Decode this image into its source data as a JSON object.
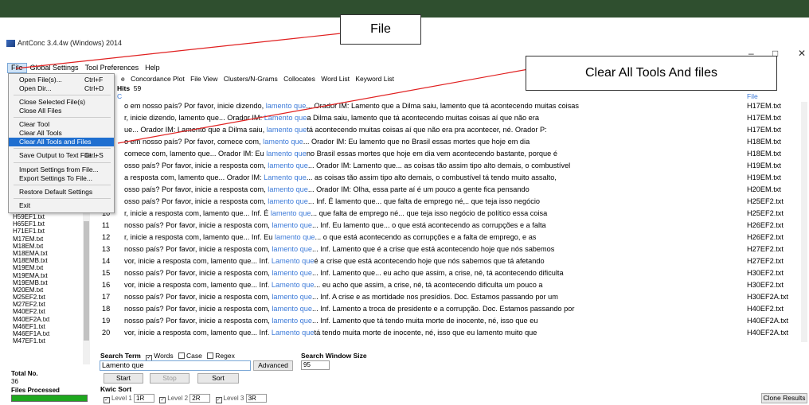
{
  "window": {
    "title": "AntConc 3.4.4w (Windows) 2014",
    "minimize": "–",
    "maximize": "□",
    "close": "✕"
  },
  "menubar": [
    "File",
    "Global Settings",
    "Tool Preferences",
    "Help"
  ],
  "file_menu": [
    {
      "label": "Open File(s)...",
      "shortcut": "Ctrl+F"
    },
    {
      "label": "Open Dir...",
      "shortcut": "Ctrl+D"
    },
    {
      "label": "Close Selected File(s)",
      "shortcut": ""
    },
    {
      "label": "Close All Files",
      "shortcut": ""
    },
    {
      "label": "Clear Tool",
      "shortcut": ""
    },
    {
      "label": "Clear All Tools",
      "shortcut": ""
    },
    {
      "label": "Clear All Tools and Files",
      "shortcut": ""
    },
    {
      "label": "Save Output to Text File...",
      "shortcut": "Ctrl+S"
    },
    {
      "label": "Import Settings from File...",
      "shortcut": ""
    },
    {
      "label": "Export Settings To File...",
      "shortcut": ""
    },
    {
      "label": "Restore Default Settings",
      "shortcut": ""
    },
    {
      "label": "Exit",
      "shortcut": ""
    }
  ],
  "tabs": [
    "e",
    "Concordance Plot",
    "File View",
    "Clusters/N-Grams",
    "Collocates",
    "Word List",
    "Keyword List"
  ],
  "hits_label": "Hits",
  "hits_value": "59",
  "kwic_label": "C",
  "file_label": "File",
  "file_list": [
    "H59EF1.txt",
    "H65EF1.txt",
    "H71EF1.txt",
    "M17EM.txt",
    "M18EM.txt",
    "M18EMA.txt",
    "M18EMB.txt",
    "M19EM.txt",
    "M19EMA.txt",
    "M19EMB.txt",
    "M20EM.txt",
    "M25EF2.txt",
    "M27EF2.txt",
    "M40EF2.txt",
    "M40EF2A.txt",
    "M46EF1.txt",
    "M46EF1A.txt",
    "M47EF1.txt"
  ],
  "total_no_label": "Total No.",
  "total_no_value": "36",
  "files_processed_label": "Files Processed",
  "files_processed_fraction": 1.0,
  "hits": [
    {
      "num": "",
      "left": "o em nosso país? Por favor, inicie dizendo,",
      "kw": "lamento que",
      "right": "... Orador IM: Lamento que a Dilma saiu, lamento que tá acontecendo muitas coisas",
      "file": "H17EM.txt"
    },
    {
      "num": "",
      "left": "r, inicie dizendo, lamento que... Orador IM:",
      "kw": "Lamento que",
      "right": "a Dilma saiu, lamento que tá acontecendo muitas coisas aí que não era",
      "file": "H17EM.txt"
    },
    {
      "num": "",
      "left": "ue... Orador IM: Lamento que a Dilma saiu,",
      "kw": "lamento que",
      "right": "tá acontecendo muitas coisas aí que não era pra acontecer, né. Orador P:",
      "file": "H17EM.txt"
    },
    {
      "num": "",
      "left": "o em nosso país? Por favor, comece com,",
      "kw": "lamento que",
      "right": "... Orador IM: Eu lamento que no Brasil essas mortes que hoje em dia",
      "file": "H18EM.txt"
    },
    {
      "num": "",
      "left": "comece com, lamento que... Orador IM: Eu",
      "kw": "lamento que",
      "right": "no Brasil essas mortes que hoje em dia vem acontecendo bastante, porque é",
      "file": "H18EM.txt"
    },
    {
      "num": "",
      "left": "osso país? Por favor, inicie a resposta com,",
      "kw": "lamento que",
      "right": "... Orador IM: Lamento que... as coisas tão assim tipo alto demais, o combustível",
      "file": "H19EM.txt"
    },
    {
      "num": "",
      "left": "a resposta com, lamento que... Orador IM:",
      "kw": "Lamento que",
      "right": "... as coisas tão assim tipo alto demais, o combustível tá tendo muito assalto,",
      "file": "H19EM.txt"
    },
    {
      "num": "",
      "left": "osso país? Por favor, inicie a resposta com,",
      "kw": "lamento que",
      "right": "... Orador IM: Olha, essa parte aí é um pouco a gente fica pensando",
      "file": "H20EM.txt"
    },
    {
      "num": "",
      "left": "osso país? Por favor, inicie a resposta com,",
      "kw": "lamento que",
      "right": "... Inf. É lamento que... que falta de emprego né,.. que teja isso negócio",
      "file": "H25EF2.txt"
    },
    {
      "num": "10",
      "left": "r, inicie a resposta com, lamento que... Inf. É",
      "kw": "lamento que",
      "right": "... que falta de emprego né... que teja isso negócio de político essa coisa",
      "file": "H25EF2.txt"
    },
    {
      "num": "11",
      "left": "nosso país? Por favor, inicie a resposta com,",
      "kw": "lamento que",
      "right": "... Inf. Eu lamento que... o que está acontecendo as corrupções e a falta",
      "file": "H26EF2.txt"
    },
    {
      "num": "12",
      "left": "r, inicie a resposta com, lamento que... Inf. Eu",
      "kw": "lamento que",
      "right": "... o que está acontecendo as corrupções e a falta de emprego, e as",
      "file": "H26EF2.txt"
    },
    {
      "num": "13",
      "left": "nosso país? Por favor, inicie a resposta com,",
      "kw": "lamento que",
      "right": "... Inf. Lamento que é a crise que está acontecendo hoje que nós sabemos",
      "file": "H27EF2.txt"
    },
    {
      "num": "14",
      "left": "vor, inicie a resposta com, lamento que... Inf.",
      "kw": "Lamento que",
      "right": "é a crise que está acontecendo hoje que nós sabemos que tá afetando",
      "file": "H27EF2.txt"
    },
    {
      "num": "15",
      "left": "nosso país? Por favor, inicie a resposta com,",
      "kw": "lamento que",
      "right": "... Inf. Lamento que... eu acho que assim, a crise, né, tá acontecendo dificulta",
      "file": "H30EF2.txt"
    },
    {
      "num": "16",
      "left": "vor, inicie a resposta com, lamento que... Inf.",
      "kw": "Lamento que",
      "right": "... eu acho que assim, a crise, né, tá acontecendo dificulta um pouco a",
      "file": "H30EF2.txt"
    },
    {
      "num": "17",
      "left": "nosso país? Por favor, inicie a resposta com,",
      "kw": "lamento que",
      "right": "... Inf. A crise e as mortidade nos presídios. Doc. Estamos passando por um",
      "file": "H30EF2A.txt"
    },
    {
      "num": "18",
      "left": "nosso país? Por favor, inicie a resposta com,",
      "kw": "lamento que",
      "right": "... Inf. Lamento a troca de presidente e a corrupção. Doc. Estamos passando por",
      "file": "H40EF2.txt"
    },
    {
      "num": "19",
      "left": "nosso país? Por favor, inicie a resposta com,",
      "kw": "lamento que",
      "right": "... Inf. Lamento que tá tendo muita morte de inocente, né, isso que eu",
      "file": "H40EF2A.txt"
    },
    {
      "num": "20",
      "left": "vor, inicie a resposta com, lamento que... Inf.",
      "kw": "Lamento que",
      "right": "tá tendo muita morte de inocente, né, isso que eu lamento muito que",
      "file": "H40EF2A.txt"
    }
  ],
  "search_term_label": "Search Term",
  "words_label": "Words",
  "case_label": "Case",
  "regex_label": "Regex",
  "search_value": "Lamento que",
  "advanced_label": "Advanced",
  "search_window_label": "Search Window Size",
  "search_window_value": "95",
  "start_label": "Start",
  "stop_label": "Stop",
  "sort_label": "Sort",
  "kwic_sort_label": "Kwic Sort",
  "level1_label": "Level 1",
  "level1_value": "1R",
  "level2_label": "Level 2",
  "level2_value": "2R",
  "level3_label": "Level 3",
  "level3_value": "3R",
  "clone_results_label": "Clone Results",
  "callouts": {
    "file": "File",
    "clear_all": "Clear All Tools And files"
  },
  "colors": {
    "keyword": "#3c7ad8",
    "highlight": "#1f6fd0",
    "progress": "#1ea81e",
    "annotation_line": "#e02020"
  }
}
